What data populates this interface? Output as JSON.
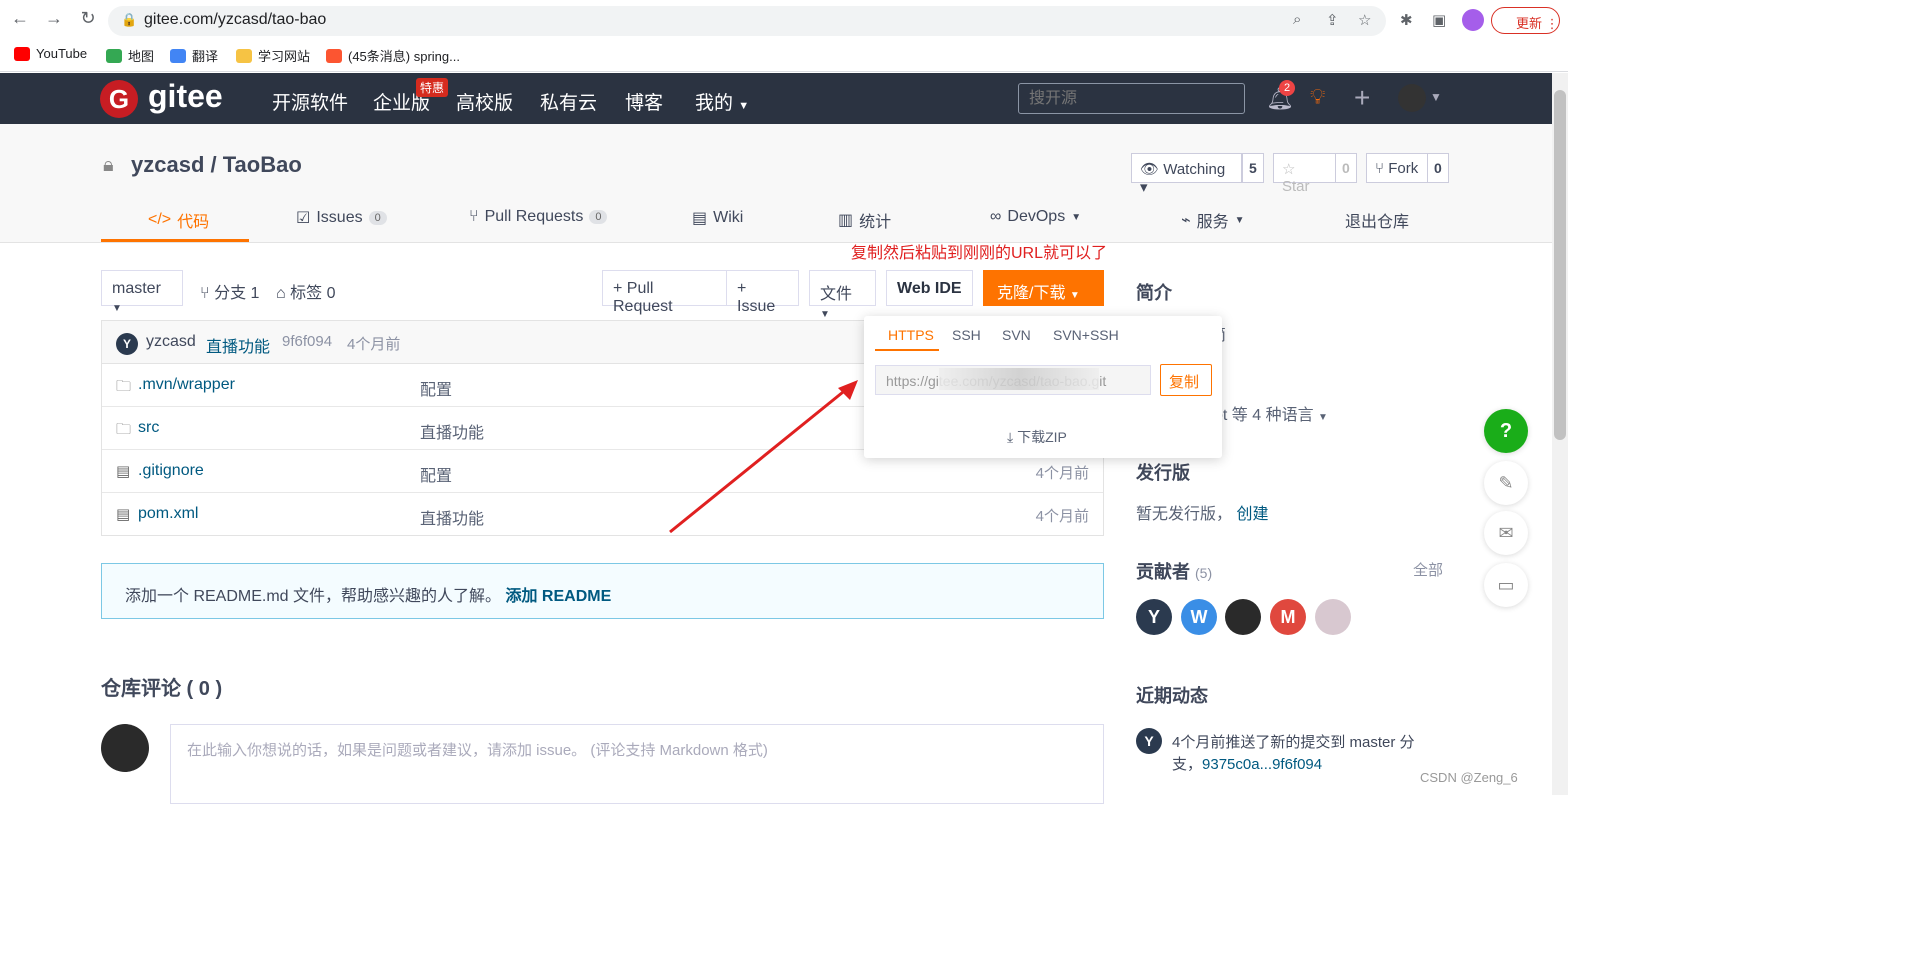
{
  "browser": {
    "url": "gitee.com/yzcasd/tao-bao",
    "update_label": "更新",
    "bookmarks": [
      {
        "label": "YouTube",
        "color": "#ff0000"
      },
      {
        "label": "地图",
        "color": "#34a853"
      },
      {
        "label": "翻译",
        "color": "#4285f4"
      },
      {
        "label": "学习网站",
        "color": "#f6c344"
      },
      {
        "label": "(45条消息) spring...",
        "color": "#fc5531"
      }
    ]
  },
  "topnav": {
    "brand": "gitee",
    "logo_letter": "G",
    "items": [
      "开源软件",
      "企业版",
      "高校版",
      "私有云",
      "博客",
      "我的"
    ],
    "badge": "特惠",
    "search_placeholder": "搜开源",
    "notification_count": "2"
  },
  "repo": {
    "title": "yzcasd / TaoBao",
    "watch_label": "Watching",
    "watch_count": "5",
    "star_label": "Star",
    "star_count": "0",
    "fork_label": "Fork",
    "fork_count": "0"
  },
  "tabs": [
    {
      "label": "代码"
    },
    {
      "label": "Issues",
      "count": "0"
    },
    {
      "label": "Pull Requests",
      "count": "0"
    },
    {
      "label": "Wiki"
    },
    {
      "label": "统计"
    },
    {
      "label": "DevOps"
    },
    {
      "label": "服务"
    },
    {
      "label": "退出仓库"
    }
  ],
  "annotation": "复制然后粘贴到刚刚的URL就可以了",
  "toolbar": {
    "branch": "master",
    "branches": "分支 1",
    "tags": "标签 0",
    "pull_request": "+ Pull Request",
    "issue": "+ Issue",
    "file": "文件",
    "webide": "Web IDE",
    "clone": "克隆/下载"
  },
  "commit": {
    "avatar": "Y",
    "author": "yzcasd",
    "message": "直播功能",
    "hash": "9f6f094",
    "time": "4个月前"
  },
  "files": [
    {
      "name": ".mvn/wrapper",
      "message": "配置",
      "time": ""
    },
    {
      "name": "src",
      "message": "直播功能",
      "time": ""
    },
    {
      "name": ".gitignore",
      "message": "配置",
      "time": "4个月前"
    },
    {
      "name": "pom.xml",
      "message": "直播功能",
      "time": "4个月前"
    }
  ],
  "readme": {
    "text": "添加一个 README.md 文件，帮助感兴趣的人了解。",
    "link": "添加 README"
  },
  "comments": {
    "title": "仓库评论 ( 0 )",
    "placeholder": "在此输入你想说的话，如果是问题或者建议，请添加 issue。 (评论支持 Markdown 格式)"
  },
  "clone_popup": {
    "tabs": [
      "HTTPS",
      "SSH",
      "SVN",
      "SVN+SSH"
    ],
    "url": "https://gitee.com/yzcasd/tao-bao.git",
    "copy": "复制",
    "zip": "下载ZIP"
  },
  "sidebar": {
    "intro_title": "简介",
    "intro_partial": "简",
    "lang_partial": "ot 等 4 种语言",
    "release_title": "发行版",
    "release_text": "暂无发行版，",
    "release_link": "创建",
    "contrib_title": "贡献者",
    "contrib_count": "(5)",
    "contrib_all": "全部",
    "contributors": [
      {
        "letter": "Y",
        "color": "#2b3a4f"
      },
      {
        "letter": "W",
        "color": "#3a8ee6"
      },
      {
        "letter": "",
        "color": "#2a2a2a"
      },
      {
        "letter": "M",
        "color": "#e0483e"
      },
      {
        "letter": "",
        "color": "#d8c8d0"
      }
    ],
    "activity_title": "近期动态",
    "activity_avatar": "Y",
    "activity_line1": "4个月前推送了新的提交到 master 分",
    "activity_line2_prefix": "支，",
    "activity_line2_link": "9375c0a...9f6f094"
  },
  "watermark": "CSDN @Zeng_6"
}
